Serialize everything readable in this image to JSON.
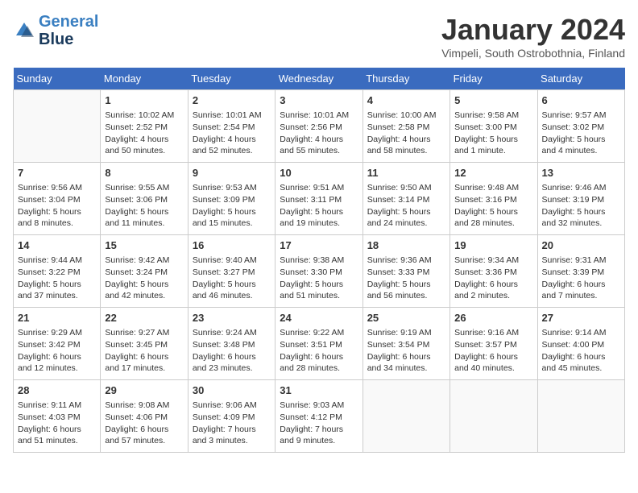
{
  "logo": {
    "line1": "General",
    "line2": "Blue"
  },
  "title": "January 2024",
  "subtitle": "Vimpeli, South Ostrobothnia, Finland",
  "days_of_week": [
    "Sunday",
    "Monday",
    "Tuesday",
    "Wednesday",
    "Thursday",
    "Friday",
    "Saturday"
  ],
  "weeks": [
    [
      {
        "day": "",
        "info": ""
      },
      {
        "day": "1",
        "info": "Sunrise: 10:02 AM\nSunset: 2:52 PM\nDaylight: 4 hours\nand 50 minutes."
      },
      {
        "day": "2",
        "info": "Sunrise: 10:01 AM\nSunset: 2:54 PM\nDaylight: 4 hours\nand 52 minutes."
      },
      {
        "day": "3",
        "info": "Sunrise: 10:01 AM\nSunset: 2:56 PM\nDaylight: 4 hours\nand 55 minutes."
      },
      {
        "day": "4",
        "info": "Sunrise: 10:00 AM\nSunset: 2:58 PM\nDaylight: 4 hours\nand 58 minutes."
      },
      {
        "day": "5",
        "info": "Sunrise: 9:58 AM\nSunset: 3:00 PM\nDaylight: 5 hours\nand 1 minute."
      },
      {
        "day": "6",
        "info": "Sunrise: 9:57 AM\nSunset: 3:02 PM\nDaylight: 5 hours\nand 4 minutes."
      }
    ],
    [
      {
        "day": "7",
        "info": "Sunrise: 9:56 AM\nSunset: 3:04 PM\nDaylight: 5 hours\nand 8 minutes."
      },
      {
        "day": "8",
        "info": "Sunrise: 9:55 AM\nSunset: 3:06 PM\nDaylight: 5 hours\nand 11 minutes."
      },
      {
        "day": "9",
        "info": "Sunrise: 9:53 AM\nSunset: 3:09 PM\nDaylight: 5 hours\nand 15 minutes."
      },
      {
        "day": "10",
        "info": "Sunrise: 9:51 AM\nSunset: 3:11 PM\nDaylight: 5 hours\nand 19 minutes."
      },
      {
        "day": "11",
        "info": "Sunrise: 9:50 AM\nSunset: 3:14 PM\nDaylight: 5 hours\nand 24 minutes."
      },
      {
        "day": "12",
        "info": "Sunrise: 9:48 AM\nSunset: 3:16 PM\nDaylight: 5 hours\nand 28 minutes."
      },
      {
        "day": "13",
        "info": "Sunrise: 9:46 AM\nSunset: 3:19 PM\nDaylight: 5 hours\nand 32 minutes."
      }
    ],
    [
      {
        "day": "14",
        "info": "Sunrise: 9:44 AM\nSunset: 3:22 PM\nDaylight: 5 hours\nand 37 minutes."
      },
      {
        "day": "15",
        "info": "Sunrise: 9:42 AM\nSunset: 3:24 PM\nDaylight: 5 hours\nand 42 minutes."
      },
      {
        "day": "16",
        "info": "Sunrise: 9:40 AM\nSunset: 3:27 PM\nDaylight: 5 hours\nand 46 minutes."
      },
      {
        "day": "17",
        "info": "Sunrise: 9:38 AM\nSunset: 3:30 PM\nDaylight: 5 hours\nand 51 minutes."
      },
      {
        "day": "18",
        "info": "Sunrise: 9:36 AM\nSunset: 3:33 PM\nDaylight: 5 hours\nand 56 minutes."
      },
      {
        "day": "19",
        "info": "Sunrise: 9:34 AM\nSunset: 3:36 PM\nDaylight: 6 hours\nand 2 minutes."
      },
      {
        "day": "20",
        "info": "Sunrise: 9:31 AM\nSunset: 3:39 PM\nDaylight: 6 hours\nand 7 minutes."
      }
    ],
    [
      {
        "day": "21",
        "info": "Sunrise: 9:29 AM\nSunset: 3:42 PM\nDaylight: 6 hours\nand 12 minutes."
      },
      {
        "day": "22",
        "info": "Sunrise: 9:27 AM\nSunset: 3:45 PM\nDaylight: 6 hours\nand 17 minutes."
      },
      {
        "day": "23",
        "info": "Sunrise: 9:24 AM\nSunset: 3:48 PM\nDaylight: 6 hours\nand 23 minutes."
      },
      {
        "day": "24",
        "info": "Sunrise: 9:22 AM\nSunset: 3:51 PM\nDaylight: 6 hours\nand 28 minutes."
      },
      {
        "day": "25",
        "info": "Sunrise: 9:19 AM\nSunset: 3:54 PM\nDaylight: 6 hours\nand 34 minutes."
      },
      {
        "day": "26",
        "info": "Sunrise: 9:16 AM\nSunset: 3:57 PM\nDaylight: 6 hours\nand 40 minutes."
      },
      {
        "day": "27",
        "info": "Sunrise: 9:14 AM\nSunset: 4:00 PM\nDaylight: 6 hours\nand 45 minutes."
      }
    ],
    [
      {
        "day": "28",
        "info": "Sunrise: 9:11 AM\nSunset: 4:03 PM\nDaylight: 6 hours\nand 51 minutes."
      },
      {
        "day": "29",
        "info": "Sunrise: 9:08 AM\nSunset: 4:06 PM\nDaylight: 6 hours\nand 57 minutes."
      },
      {
        "day": "30",
        "info": "Sunrise: 9:06 AM\nSunset: 4:09 PM\nDaylight: 7 hours\nand 3 minutes."
      },
      {
        "day": "31",
        "info": "Sunrise: 9:03 AM\nSunset: 4:12 PM\nDaylight: 7 hours\nand 9 minutes."
      },
      {
        "day": "",
        "info": ""
      },
      {
        "day": "",
        "info": ""
      },
      {
        "day": "",
        "info": ""
      }
    ]
  ]
}
